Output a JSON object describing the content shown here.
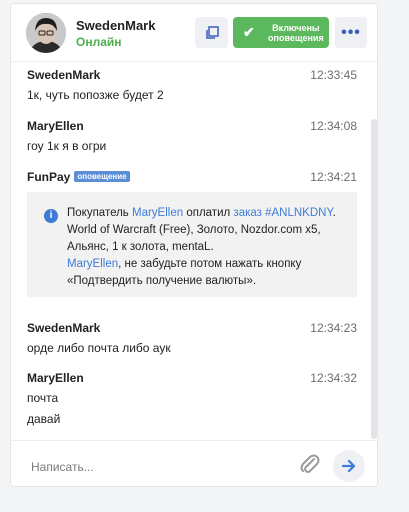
{
  "header": {
    "name": "SwedenMark",
    "status": "Онлайн",
    "notifications_label": "Включены оповещения",
    "more_label": "•••"
  },
  "messages": [
    {
      "author": "SwedenMark",
      "time": "12:33:45",
      "lines": [
        "1к, чуть попозже будет 2"
      ]
    },
    {
      "author": "MaryEllen",
      "time": "12:34:08",
      "lines": [
        "гоу 1к я в огри"
      ]
    },
    {
      "author": "FunPay",
      "badge": "оповещение",
      "time": "12:34:21",
      "notice": {
        "p1": "Покупатель ",
        "buyer": "MaryEllen",
        "p2": " оплатил ",
        "order": "заказ #ANLNKDNY",
        "p3": ". World of Warcraft (Free), Золото, Nozdor.com x5, Альянс, 1 к золота, mentaL.",
        "buyer2": "MaryEllen",
        "p4": ", не забудьте потом нажать кнопку «Подтвердить получение валюты»."
      }
    },
    {
      "author": "SwedenMark",
      "time": "12:34:23",
      "lines": [
        "орде либо почта либо аук"
      ]
    },
    {
      "author": "MaryEllen",
      "time": "12:34:32",
      "lines": [
        "почта",
        "давай"
      ]
    }
  ],
  "composer": {
    "placeholder": "Написать..."
  },
  "colors": {
    "accent_green": "#5cb85c",
    "link_blue": "#3f7bd6",
    "online_green": "#4caf50"
  }
}
